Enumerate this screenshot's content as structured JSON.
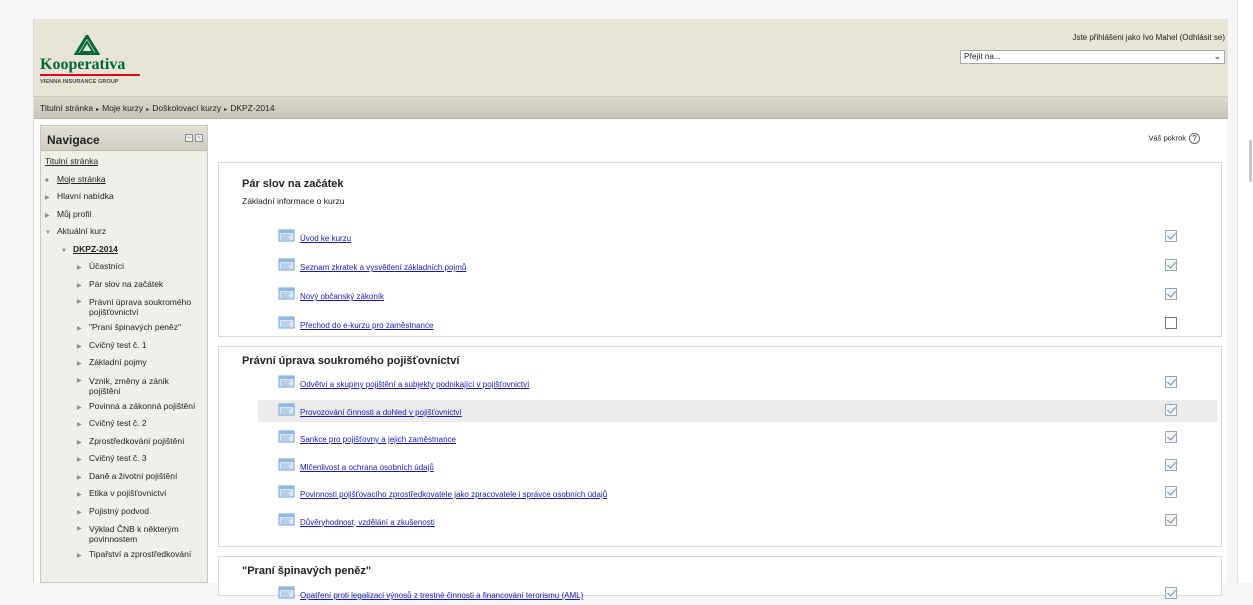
{
  "header": {
    "logo_text": "Kooperativa",
    "logo_sub": "VIENNA INSURANCE GROUP",
    "login_prefix": "Jste přihlášeni jako",
    "login_user": "Ivo Mahel",
    "logout_label": "(Odhlásit se)",
    "jump_placeholder": "Přejít na...",
    "brand_green": "#006837",
    "brand_red": "#e2001a"
  },
  "breadcrumb": [
    "Titulní stránka",
    "Moje kurzy",
    "Doškolovací kurzy",
    "DKPZ-2014"
  ],
  "navigation": {
    "title": "Navigace",
    "items": [
      {
        "label": "Titulní stránka",
        "level": 0,
        "icon": "none",
        "style": "link"
      },
      {
        "label": "Moje stránka",
        "level": 1,
        "icon": "bullet",
        "style": "link"
      },
      {
        "label": "Hlavní nabídka",
        "level": 1,
        "icon": "collapsed-triangle",
        "style": "plain"
      },
      {
        "label": "Můj profil",
        "level": 1,
        "icon": "collapsed-triangle",
        "style": "plain"
      },
      {
        "label": "Aktuální kurz",
        "level": 1,
        "icon": "expanded-triangle",
        "style": "plain"
      },
      {
        "label": "DKPZ-2014",
        "level": 2,
        "icon": "expanded-triangle",
        "style": "bold"
      },
      {
        "label": "Účastníci",
        "level": 3,
        "icon": "collapsed-triangle",
        "style": "plain"
      },
      {
        "label": "Pár slov na začátek",
        "level": 3,
        "icon": "collapsed-triangle",
        "style": "plain"
      },
      {
        "label": "Právní úprava soukromého pojišťovnictví",
        "level": 3,
        "icon": "collapsed-triangle",
        "style": "plain",
        "wrap": true
      },
      {
        "label": "\"Praní špinavých peněz\"",
        "level": 3,
        "icon": "collapsed-triangle",
        "style": "plain"
      },
      {
        "label": "Cvičný test č. 1",
        "level": 3,
        "icon": "collapsed-triangle",
        "style": "plain"
      },
      {
        "label": "Základní pojmy",
        "level": 3,
        "icon": "collapsed-triangle",
        "style": "plain"
      },
      {
        "label": "Vznik, změny a zánik pojištění",
        "level": 3,
        "icon": "collapsed-triangle",
        "style": "plain",
        "wrap": true
      },
      {
        "label": "Povinná a zákonná pojištění",
        "level": 3,
        "icon": "collapsed-triangle",
        "style": "plain"
      },
      {
        "label": "Cvičný test č. 2",
        "level": 3,
        "icon": "collapsed-triangle",
        "style": "plain"
      },
      {
        "label": "Zprostředkování pojištění",
        "level": 3,
        "icon": "collapsed-triangle",
        "style": "plain"
      },
      {
        "label": "Cvičný test č. 3",
        "level": 3,
        "icon": "collapsed-triangle",
        "style": "plain"
      },
      {
        "label": "Daně a životní pojištění",
        "level": 3,
        "icon": "collapsed-triangle",
        "style": "plain"
      },
      {
        "label": "Etika v pojišťovnictví",
        "level": 3,
        "icon": "collapsed-triangle",
        "style": "plain"
      },
      {
        "label": "Pojistný podvod",
        "level": 3,
        "icon": "collapsed-triangle",
        "style": "plain"
      },
      {
        "label": "Výklad ČNB k některým povinnostem",
        "level": 3,
        "icon": "collapsed-triangle",
        "style": "plain",
        "wrap": true
      },
      {
        "label": "Tipařství a zprostředkování",
        "level": 3,
        "icon": "collapsed-triangle",
        "style": "plain"
      }
    ]
  },
  "main": {
    "progress_label": "Váš pokrok",
    "sections": [
      {
        "title": "Pár slov na začátek",
        "subtitle": "Základní informace o kurzu",
        "activities": [
          {
            "label": "Úvod ke kurzu",
            "completed": true
          },
          {
            "label": "Seznam zkratek a vysvětlení základních pojmů",
            "completed": true
          },
          {
            "label": "Nový občanský zákoník",
            "completed": true
          },
          {
            "label": "Přechod do e-kurzu pro zaměstnance",
            "completed": false
          }
        ]
      },
      {
        "title": "Právní úprava soukromého pojišťovnictví",
        "subtitle": "",
        "activities": [
          {
            "label": "Odvětví a skupiny pojištění a subjekty podnikající v pojišťovnictví",
            "completed": true
          },
          {
            "label": "Provozování činnosti a dohled v pojišťovnictví",
            "completed": true,
            "highlighted": true
          },
          {
            "label": "Sankce pro pojišťovny a jejich zaměstnance",
            "completed": true
          },
          {
            "label": "Mlčenlivost a ochrana osobních údajů",
            "completed": true
          },
          {
            "label": "Povinnosti pojišťovacího zprostředkovatele jako zpracovatele i správce osobních údajů",
            "completed": true
          },
          {
            "label": "Důvěryhodnost, vzdělání a zkušenosti",
            "completed": true
          }
        ]
      },
      {
        "title": "\"Praní špinavých peněz\"",
        "subtitle": "",
        "activities": [
          {
            "label": "Opatření proti legalizaci výnosů z trestné činnosti a financování terorismu (AML)",
            "completed": true
          }
        ]
      }
    ]
  }
}
